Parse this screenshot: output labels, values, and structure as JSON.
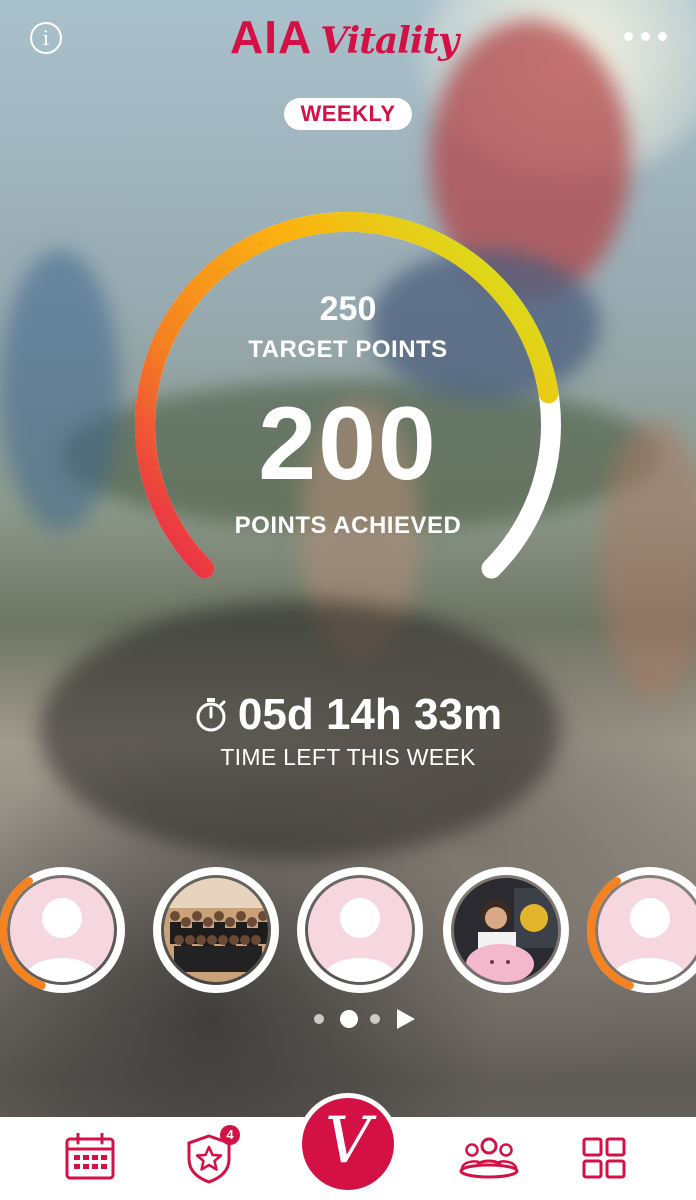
{
  "brand": {
    "name_primary": "AIA",
    "name_secondary": "Vitality",
    "color": "#d31145"
  },
  "header": {
    "info_icon": "info-icon",
    "info_glyph": "i",
    "more_icon": "more-icon"
  },
  "period": {
    "label": "WEEKLY"
  },
  "progress": {
    "target_points": "250",
    "target_label": "TARGET POINTS",
    "points_achieved": "200",
    "points_label": "POINTS ACHIEVED",
    "fraction": 0.8,
    "gradient_colors": [
      "#e8204e",
      "#f58220",
      "#fbb40f",
      "#d6e11c"
    ]
  },
  "timer": {
    "icon": "stopwatch-icon",
    "value": "05d 14h 33m",
    "label": "TIME LEFT THIS WEEK"
  },
  "friends": [
    {
      "name": "friend-1",
      "avatar": "default-avatar",
      "progress": 0.35,
      "colors": [
        "#f58220",
        "#e8204e"
      ]
    },
    {
      "name": "friend-2",
      "avatar": "group-photo",
      "progress": 0,
      "colors": []
    },
    {
      "name": "friend-3",
      "avatar": "default-avatar",
      "progress": 0,
      "colors": []
    },
    {
      "name": "friend-4",
      "avatar": "person-photo",
      "progress": 0,
      "colors": []
    },
    {
      "name": "friend-5",
      "avatar": "default-avatar",
      "progress": 0.35,
      "colors": [
        "#f58220",
        "#e8204e"
      ]
    }
  ],
  "pagination": {
    "total": 3,
    "active": 1,
    "next_icon": "chevron-right-icon"
  },
  "bottom_nav": {
    "items": [
      {
        "name": "calendar",
        "icon": "calendar-icon"
      },
      {
        "name": "rewards",
        "icon": "star-shield-icon",
        "badge": "4"
      },
      {
        "name": "vitality-home",
        "icon": "vitality-v-icon",
        "glyph": "V"
      },
      {
        "name": "community",
        "icon": "group-icon"
      },
      {
        "name": "menu",
        "icon": "grid-icon"
      }
    ]
  }
}
